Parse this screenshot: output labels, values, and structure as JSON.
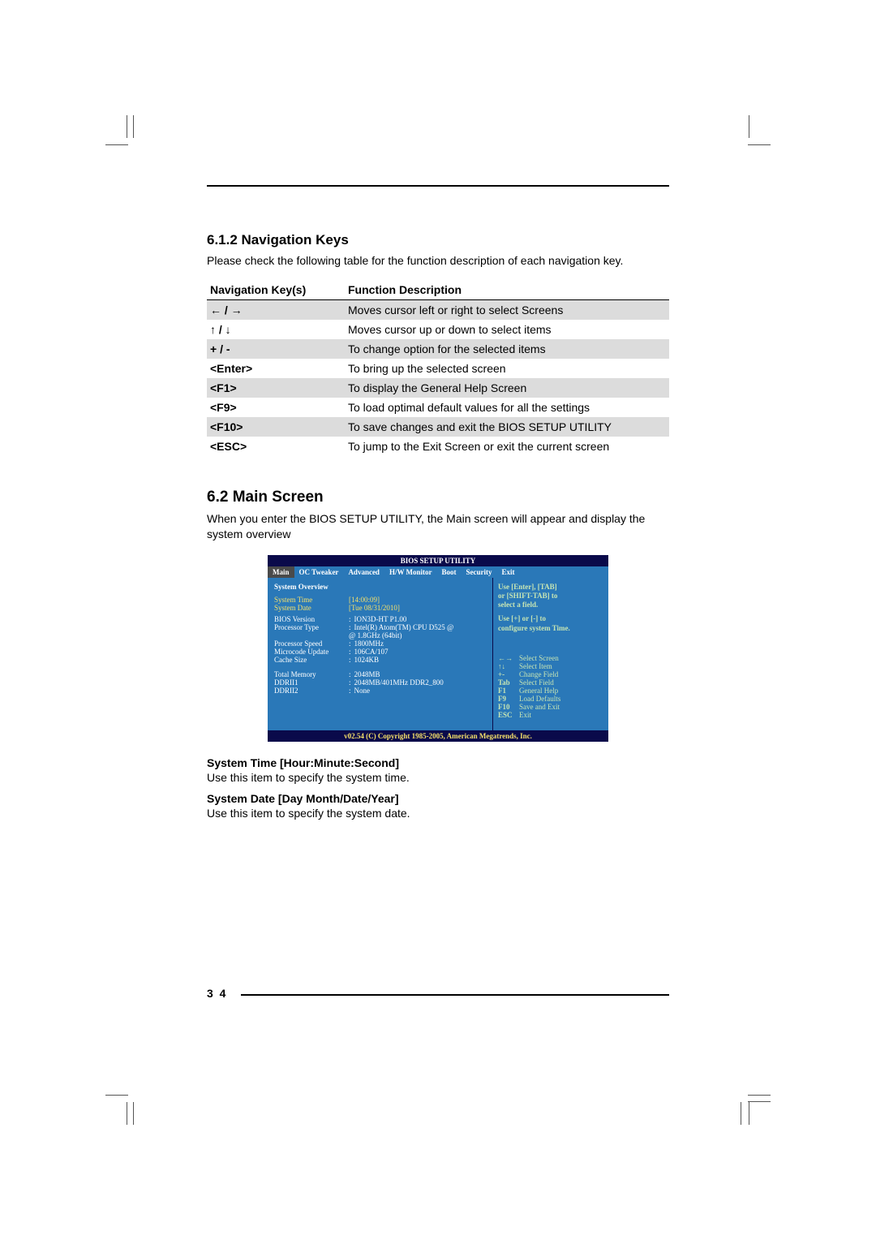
{
  "sections": {
    "nav_heading": "6.1.2 Navigation Keys",
    "nav_intro": "Please check the following table for the function description of each navigation key.",
    "main_heading": "6.2  Main Screen",
    "main_intro": "When you enter the BIOS SETUP UTILITY, the Main screen will appear and display the system overview"
  },
  "nav_table": {
    "headers": {
      "key": "Navigation Key(s)",
      "desc": "Function Description"
    },
    "rows": [
      {
        "key_html": "arrows-lr",
        "key": "← / →",
        "desc": "Moves cursor left or right to select Screens"
      },
      {
        "key_html": "arrows-ud",
        "key": "↑ / ↓",
        "desc": "Moves cursor up or down to select items"
      },
      {
        "key": "+  /  -",
        "desc": "To change option for the selected items"
      },
      {
        "key": "<Enter>",
        "desc": "To bring up the selected screen"
      },
      {
        "key": "<F1>",
        "desc": "To display the General Help Screen"
      },
      {
        "key": "<F9>",
        "desc": "To load optimal default values for all the settings"
      },
      {
        "key": "<F10>",
        "desc": "To save changes and exit the BIOS SETUP UTILITY"
      },
      {
        "key": "<ESC>",
        "desc": "To jump to the Exit Screen or exit the current screen"
      }
    ]
  },
  "bios": {
    "title": "BIOS SETUP UTILITY",
    "tabs": [
      "Main",
      "OC Tweaker",
      "Advanced",
      "H/W Monitor",
      "Boot",
      "Security",
      "Exit"
    ],
    "active_tab": "Main",
    "section": "System Overview",
    "system_time_label": "System Time",
    "system_time_value": "[14:00:09]",
    "system_date_label": "System Date",
    "system_date_value": "[Tue 08/31/2010]",
    "rows": [
      {
        "label": "BIOS Version",
        "value": "ION3D-HT P1.00"
      },
      {
        "label": "Processor Type",
        "value": "Intel(R) Atom(TM) CPU D525 @"
      },
      {
        "label": "",
        "value": "@ 1.8GHz  (64bit)"
      },
      {
        "label": "Processor Speed",
        "value": "1800MHz"
      },
      {
        "label": "Microcode Update",
        "value": "106CA/107"
      },
      {
        "label": "Cache Size",
        "value": "1024KB"
      }
    ],
    "mem_rows": [
      {
        "label": "Total Memory",
        "value": "2048MB"
      },
      {
        "label": "   DDRII1",
        "value": "2048MB/401MHz DDR2_800"
      },
      {
        "label": "   DDRII2",
        "value": "None"
      }
    ],
    "help_lines": [
      "Use [Enter], [TAB]",
      "or [SHIFT-TAB] to",
      "select a field."
    ],
    "help_lines2": [
      "Use [+] or [-] to",
      "configure system Time."
    ],
    "key_legend": [
      {
        "k": "←→",
        "d": "Select Screen"
      },
      {
        "k": "↑↓",
        "d": "Select Item"
      },
      {
        "k": "+-",
        "d": "Change Field"
      },
      {
        "k": "Tab",
        "d": "Select Field"
      },
      {
        "k": "F1",
        "d": "General Help"
      },
      {
        "k": "F9",
        "d": "Load Defaults"
      },
      {
        "k": "F10",
        "d": "Save and Exit"
      },
      {
        "k": "ESC",
        "d": "Exit"
      }
    ],
    "footer": "v02.54 (C) Copyright 1985-2005, American Megatrends, Inc."
  },
  "post_bios": {
    "time_h": "System Time [Hour:Minute:Second]",
    "time_b": "Use this item to specify the system time.",
    "date_h": "System Date [Day Month/Date/Year]",
    "date_b": "Use this item to specify the system date."
  },
  "page_number": "3 4"
}
